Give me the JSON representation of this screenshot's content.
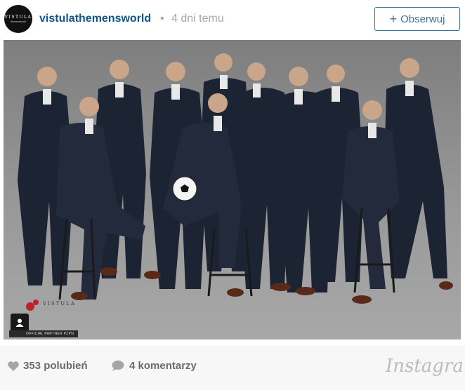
{
  "post": {
    "username": "vistulathemensworld",
    "separator": "•",
    "time": "4 dni temu",
    "follow_label": "Obserwuj",
    "follow_plus": "+"
  },
  "avatar": {
    "logo_main": "VISTULA",
    "logo_sub": "themensworld"
  },
  "photo": {
    "brand": "VISTULA",
    "caption": "OFFICIAL PARTNER PZPN"
  },
  "footer": {
    "likes": "353 polubień",
    "comments": "4 komentarzy",
    "platform": "Instagram"
  },
  "colors": {
    "username": "#125688",
    "follow_border": "#3f729b",
    "muted": "#a5a7aa",
    "footer_bg": "#f7f7f7"
  },
  "icons": [
    "heart-icon",
    "comment-icon",
    "user-tag-icon"
  ]
}
